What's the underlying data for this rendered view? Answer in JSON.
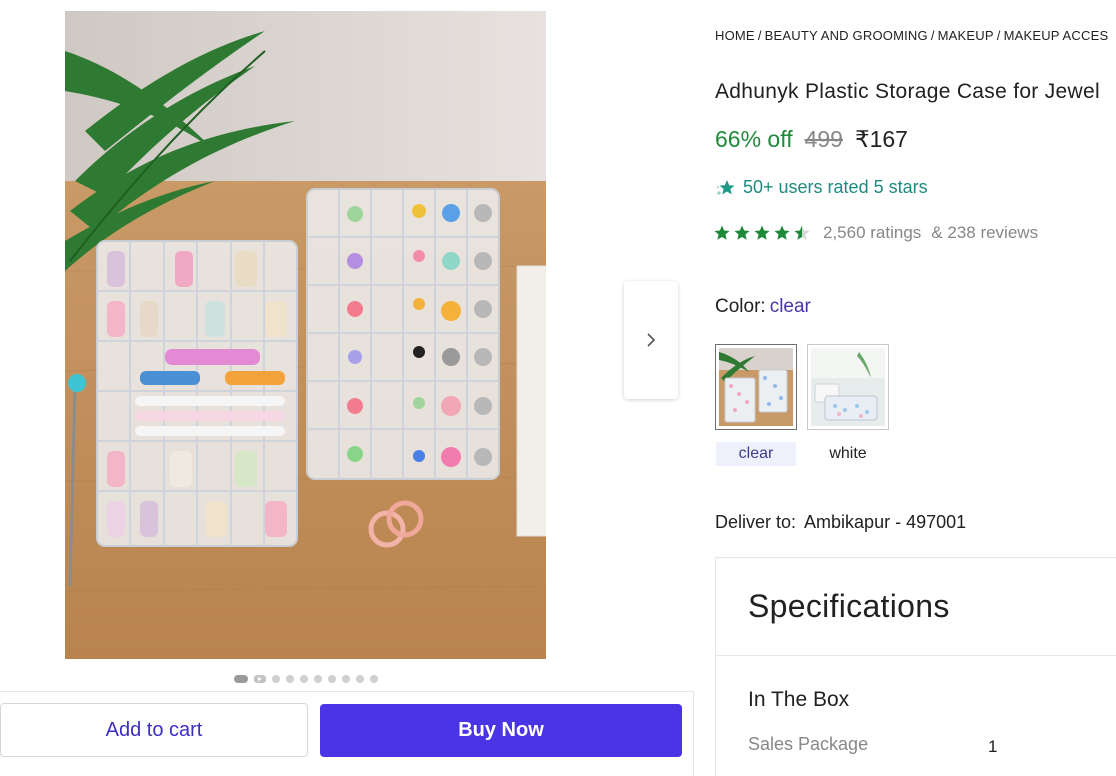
{
  "gallery": {
    "dot_count": 10,
    "active_index": 0
  },
  "actions": {
    "add_to_cart": "Add to cart",
    "buy_now": "Buy Now"
  },
  "breadcrumb": {
    "items": [
      "HOME",
      "BEAUTY AND GROOMING",
      "MAKEUP",
      "MAKEUP ACCES"
    ],
    "separator": "/"
  },
  "product": {
    "title": "Adhunyk Plastic Storage Case for Jewel",
    "discount": "66% off",
    "mrp": "499",
    "price": "₹167",
    "users_rated": "50+ users rated 5 stars",
    "rating_value": 4.5,
    "ratings_count": "2,560 ratings",
    "reviews_count": "& 238 reviews"
  },
  "color": {
    "label": "Color:",
    "selected": "clear",
    "options": [
      "clear",
      "white"
    ]
  },
  "delivery": {
    "label": "Deliver to:",
    "location": "Ambikapur - 497001"
  },
  "specifications": {
    "title": "Specifications",
    "section": "In The Box",
    "rows": [
      {
        "key": "Sales Package",
        "value": "1"
      }
    ]
  },
  "colors": {
    "accent": "#4a35e6",
    "discount_green": "#1f8a3a",
    "star_green": "#1f8a3a",
    "teal": "#1f8a7f"
  }
}
